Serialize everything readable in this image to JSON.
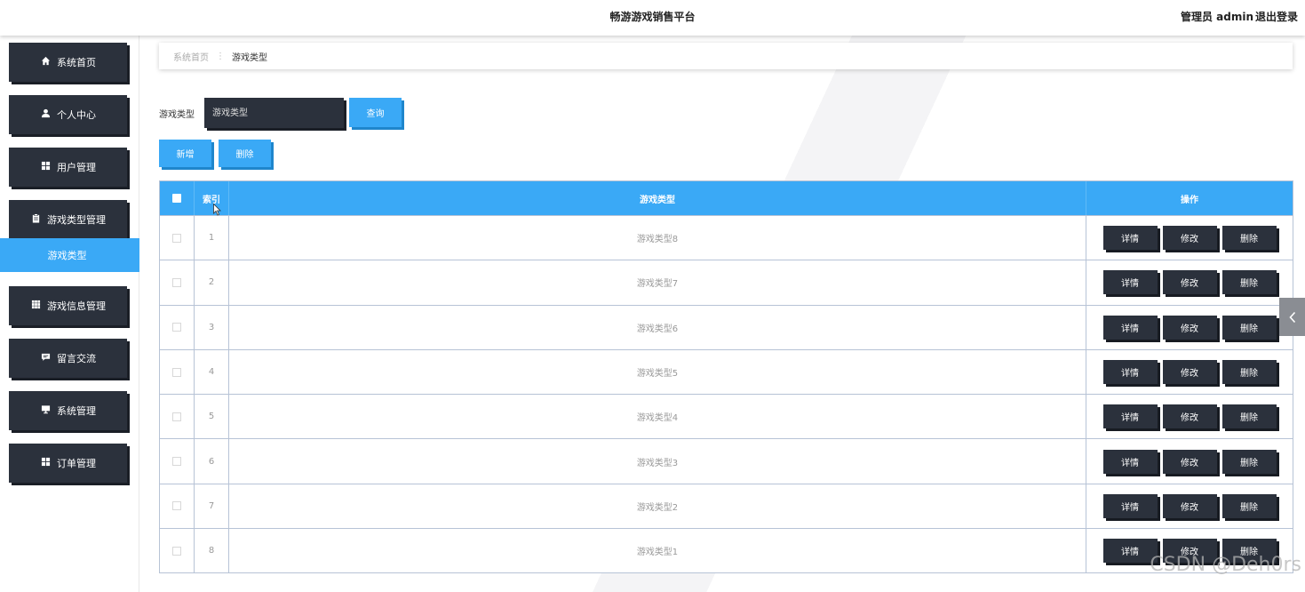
{
  "header": {
    "title": "畅游游戏销售平台",
    "user_label": "管理员 admin",
    "logout_label": "退出登录"
  },
  "sidebar": {
    "items": [
      {
        "label": "系统首页",
        "icon": "home-icon"
      },
      {
        "label": "个人中心",
        "icon": "user-icon"
      },
      {
        "label": "用户管理",
        "icon": "grid-icon"
      },
      {
        "label": "游戏类型管理",
        "icon": "clipboard-icon"
      },
      {
        "label": "游戏信息管理",
        "icon": "table-icon"
      },
      {
        "label": "留言交流",
        "icon": "comment-icon"
      },
      {
        "label": "系统管理",
        "icon": "monitor-icon"
      },
      {
        "label": "订单管理",
        "icon": "grid-icon"
      }
    ],
    "active_sub_item": "游戏类型"
  },
  "breadcrumb": {
    "home": "系统首页",
    "current": "游戏类型"
  },
  "search": {
    "label": "游戏类型",
    "placeholder": "游戏类型",
    "query_button": "查询"
  },
  "toolbar": {
    "add_button": "新增",
    "delete_button": "删除"
  },
  "table": {
    "headers": {
      "index": "索引",
      "type": "游戏类型",
      "actions": "操作"
    },
    "rows": [
      {
        "index": "1",
        "type": "游戏类型8"
      },
      {
        "index": "2",
        "type": "游戏类型7"
      },
      {
        "index": "3",
        "type": "游戏类型6"
      },
      {
        "index": "4",
        "type": "游戏类型5"
      },
      {
        "index": "5",
        "type": "游戏类型4"
      },
      {
        "index": "6",
        "type": "游戏类型3"
      },
      {
        "index": "7",
        "type": "游戏类型2"
      },
      {
        "index": "8",
        "type": "游戏类型1"
      }
    ],
    "row_actions": {
      "detail": "详情",
      "edit": "修改",
      "delete": "删除"
    }
  },
  "watermark": "CSDN @Deh0rs",
  "colors": {
    "accent": "#3aa9f6",
    "dark_button": "#2b313c",
    "table_border": "#b7c3d6"
  }
}
